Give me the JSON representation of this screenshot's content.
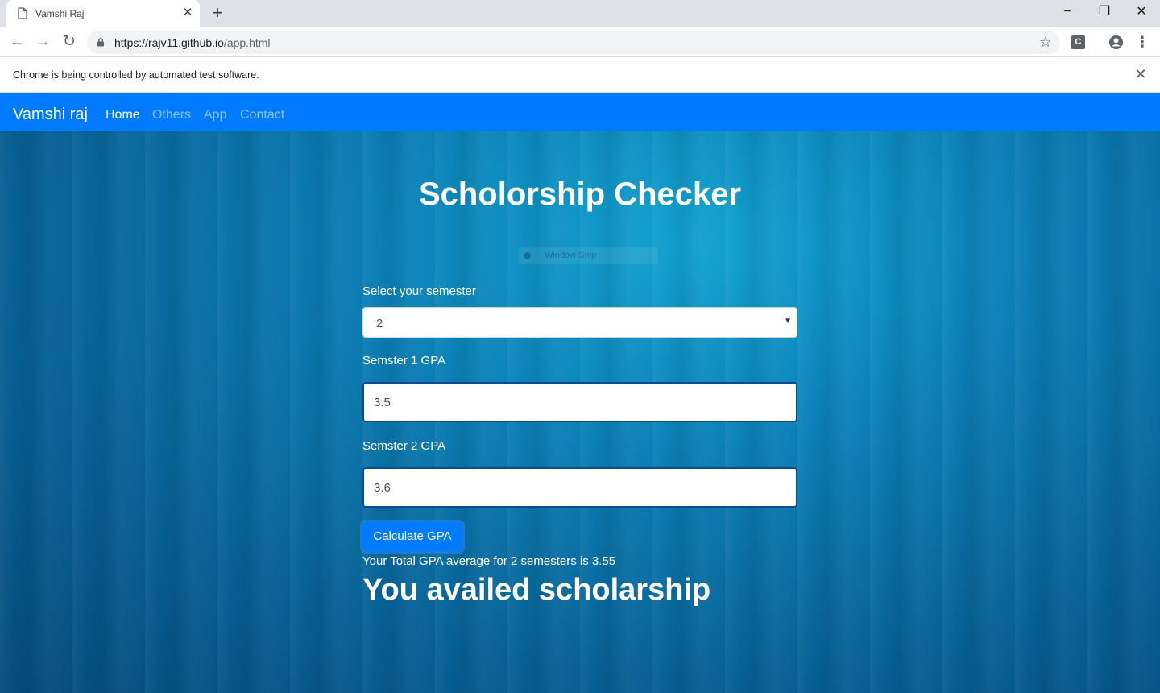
{
  "browser": {
    "tab": {
      "title": "Vamshi Raj",
      "icon": "page-icon",
      "close_glyph": "✕"
    },
    "new_tab_glyph": "+",
    "window_controls": {
      "minimize": "−",
      "restore": "❐",
      "close": "✕"
    },
    "toolbar": {
      "back": "←",
      "forward": "→",
      "reload": "↻",
      "url_host": "https://rajv11.github.io",
      "url_path": "/app.html",
      "star": "☆",
      "extension_letter": "C",
      "menu": "⋮"
    },
    "infobar": {
      "message": "Chrome is being controlled by automated test software.",
      "close_glyph": "✕"
    }
  },
  "navbar": {
    "brand": "Vamshi raj",
    "links": [
      {
        "label": "Home",
        "active": true
      },
      {
        "label": "Others",
        "active": false
      },
      {
        "label": "App",
        "active": false
      },
      {
        "label": "Contact",
        "active": false
      }
    ]
  },
  "overlay": {
    "label": "Window Snip"
  },
  "main": {
    "title": "Scholorship Checker",
    "semester_label": "Select your semester",
    "semester_value": "2",
    "semester_caret": "▼",
    "gpa_fields": [
      {
        "label": "Semster 1 GPA",
        "value": "3.5"
      },
      {
        "label": "Semster 2 GPA",
        "value": "3.6"
      }
    ],
    "calculate_button": "Calculate GPA",
    "result_text": "Your Total GPA average for 2 semesters is 3.55",
    "result_heading": "You availed scholarship"
  },
  "colors": {
    "navbar": "#007bff",
    "button": "#007bff",
    "background": "#0b7db3",
    "input_border": "#0d4a8f"
  }
}
